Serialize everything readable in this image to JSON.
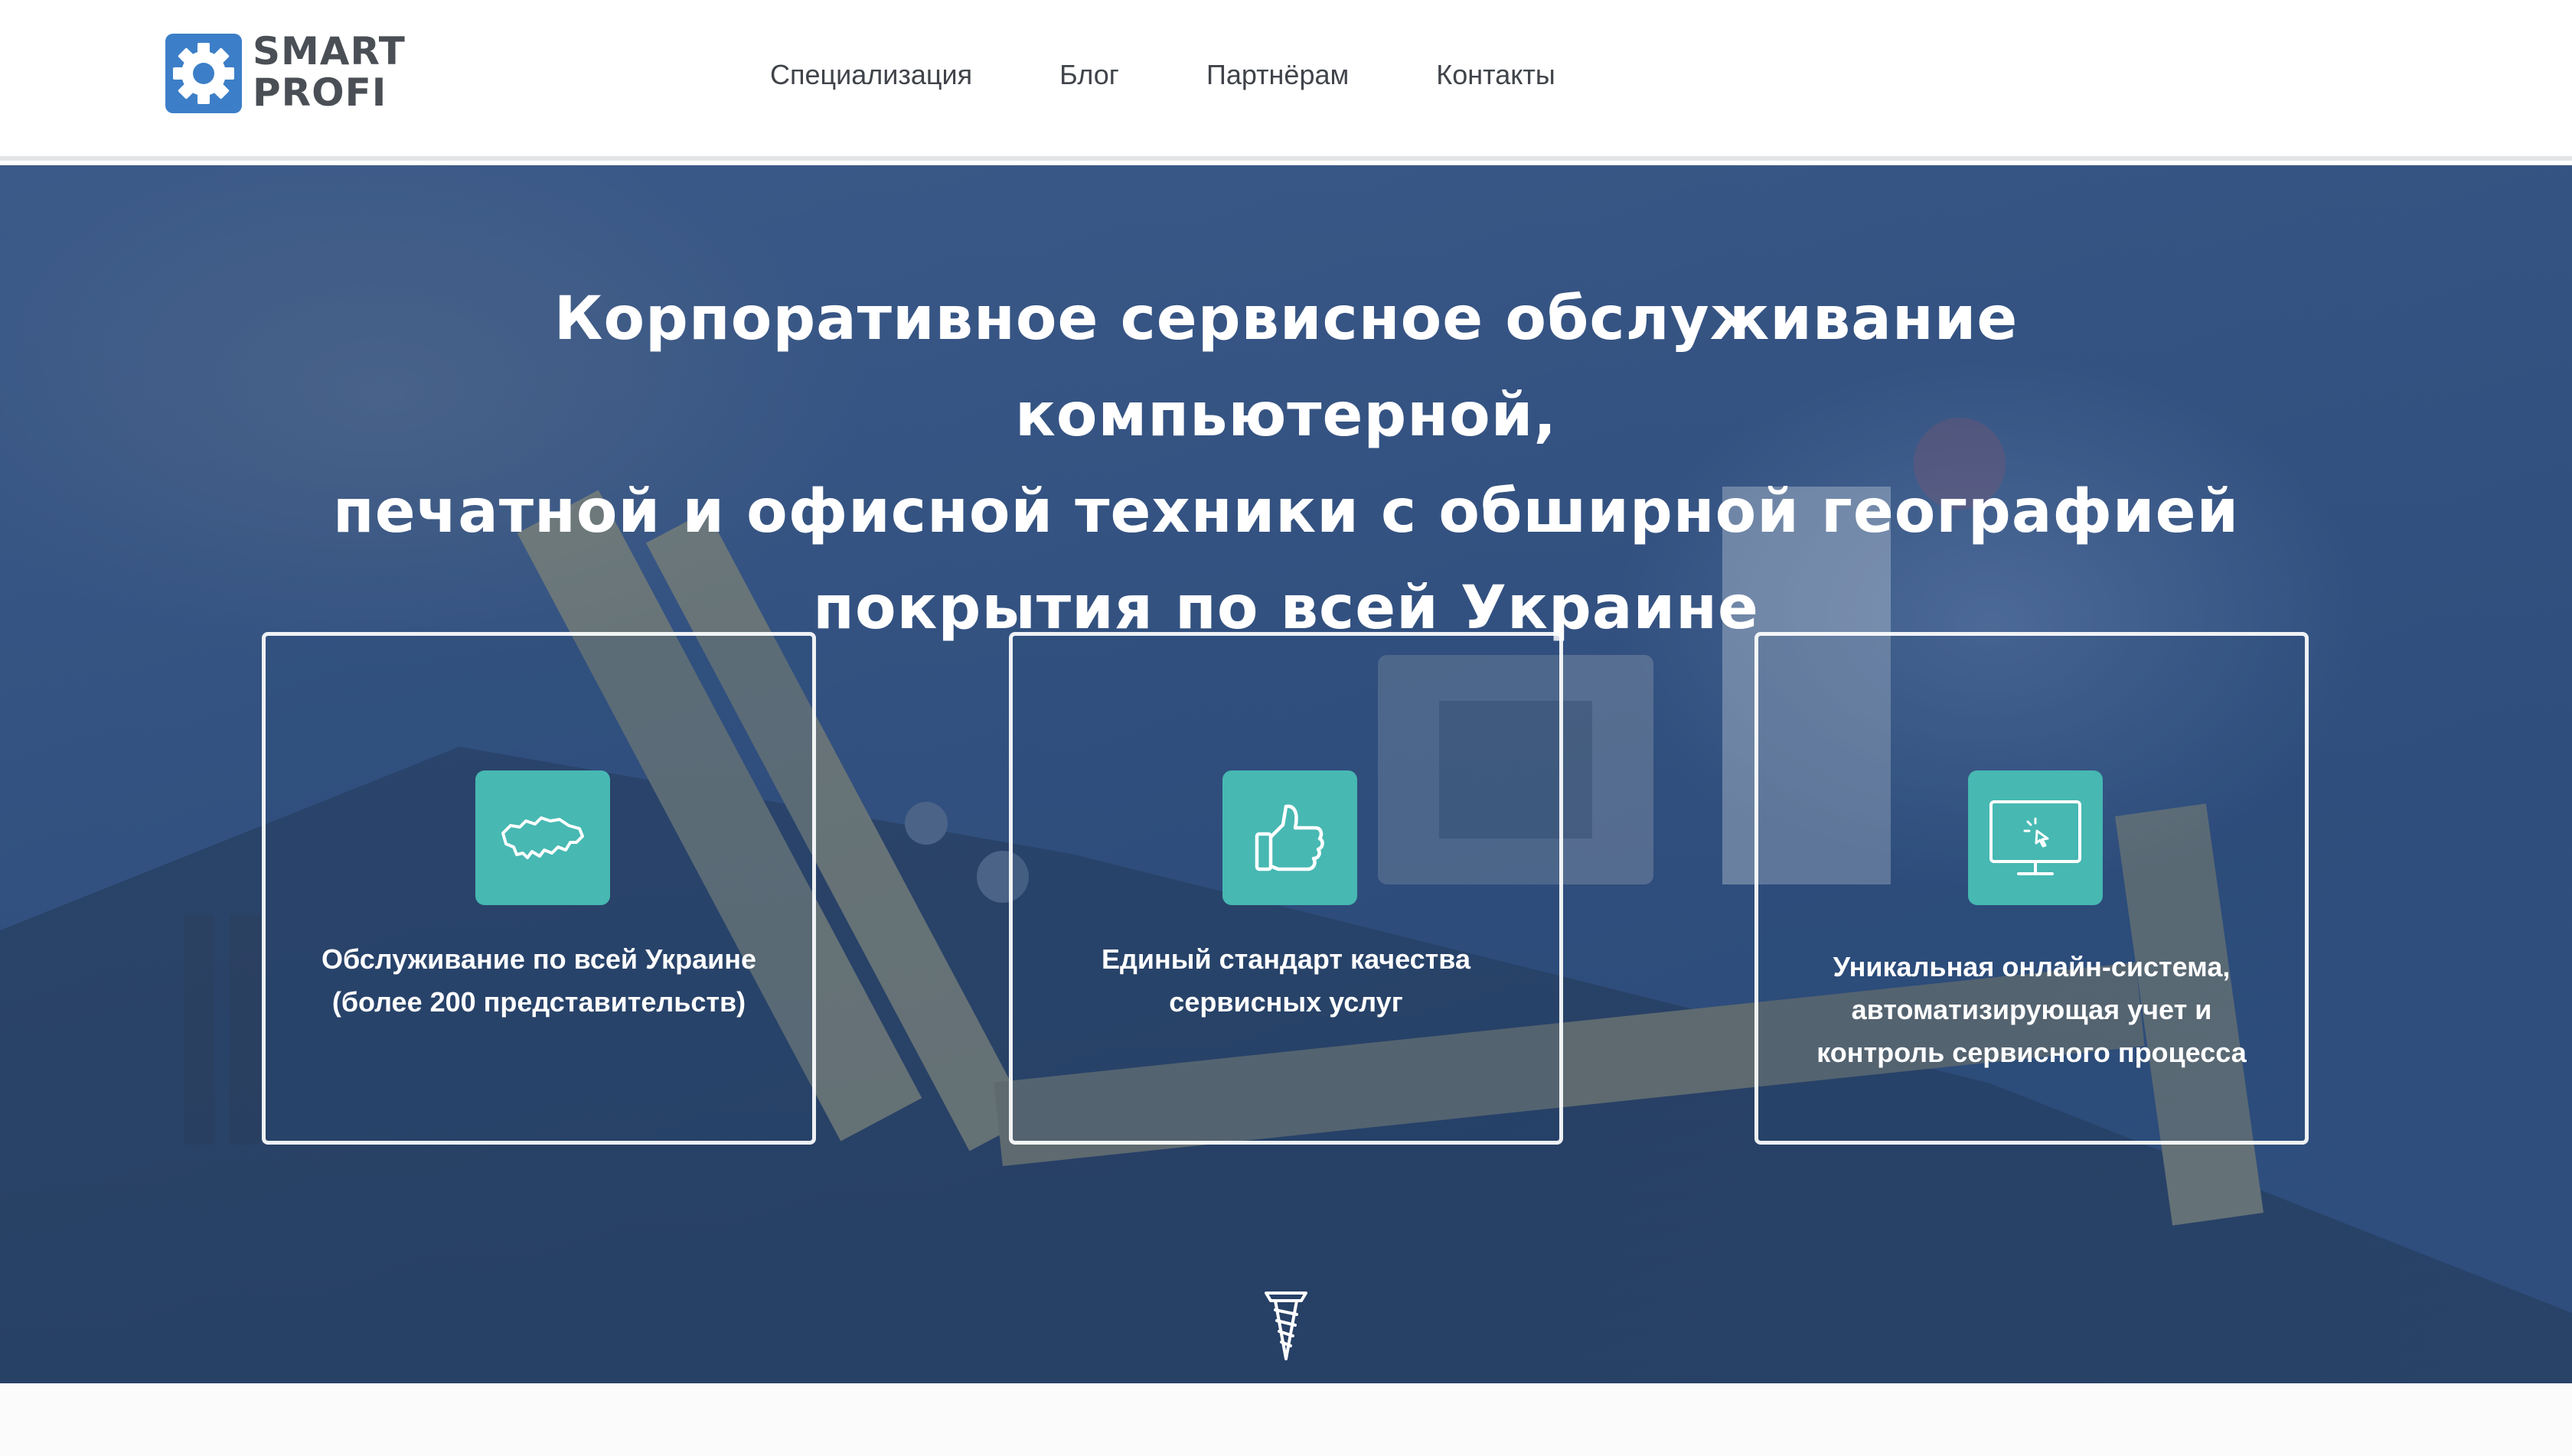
{
  "brand": {
    "line1": "SMART",
    "line2": "PROFI",
    "mark_color": "#3c7fc8",
    "text_color": "#4a4f56"
  },
  "nav": {
    "items": [
      {
        "label": "Специализация"
      },
      {
        "label": "Блог"
      },
      {
        "label": "Партнёрам"
      },
      {
        "label": "Контакты"
      }
    ]
  },
  "hero": {
    "title_lines": [
      "Корпоративное сервисное обслуживание компьютерной,",
      "печатной и офисной техники с обширной географией",
      "покрытия по всей Украине"
    ],
    "overlay_color": "#34568c"
  },
  "features": [
    {
      "icon": "ukraine-map-icon",
      "lines": [
        "Обслуживание по всей Украине",
        "(более 200 представительств)"
      ]
    },
    {
      "icon": "thumbs-up-icon",
      "lines": [
        "Единый стандарт качества",
        "сервисных услуг"
      ]
    },
    {
      "icon": "monitor-click-icon",
      "lines": [
        "Уникальная онлайн-система,",
        "автоматизирующая учет и",
        "контроль сервисного процесса"
      ]
    }
  ],
  "accent_color": "#47b8b2",
  "scroll_icon": "screw-icon",
  "callback_icon": "phone-icon"
}
